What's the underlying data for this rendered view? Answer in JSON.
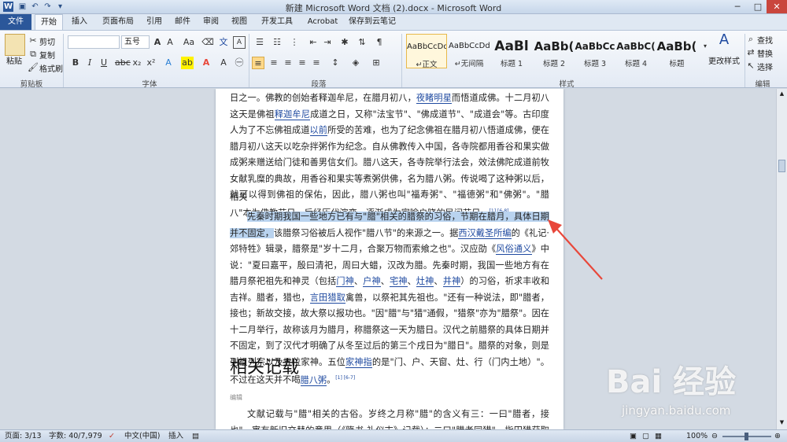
{
  "title": "新建 Microsoft Word 文档 (2).docx - Microsoft Word",
  "tabs": [
    "文件",
    "开始",
    "插入",
    "页面布局",
    "引用",
    "邮件",
    "审阅",
    "视图",
    "开发工具",
    "Acrobat",
    "保存到云笔记"
  ],
  "clipboard": {
    "paste": "粘贴",
    "cut": "剪切",
    "copy": "复制",
    "format_painter": "格式刷",
    "group": "剪贴板"
  },
  "font": {
    "name": "",
    "size": "五号",
    "group": "字体"
  },
  "paragraph_group": "段落",
  "styles": {
    "items": [
      {
        "preview": "AaBbCcDd",
        "name": "↵正文"
      },
      {
        "preview": "AaBbCcDd",
        "name": "↵无间隔"
      },
      {
        "preview": "AaBl",
        "name": "标题 1"
      },
      {
        "preview": "AaBb(",
        "name": "标题 2"
      },
      {
        "preview": "AaBbCc",
        "name": "标题 3"
      },
      {
        "preview": "AaBbC(",
        "name": "标题 4"
      },
      {
        "preview": "AaBb(",
        "name": "标题"
      }
    ],
    "change": "更改样式",
    "group": "样式"
  },
  "editing": {
    "find": "查找",
    "replace": "替换",
    "select": "选择",
    "group": "编辑"
  },
  "document": {
    "p1": "日之一。佛教的创始者释迦牟尼，在腊月初八，",
    "p1_link1": "夜睹明星",
    "p1_b": "而悟道成佛。十二月初八这天是佛祖",
    "p1_link2": "释迦牟尼",
    "p1_c": "成道之日，又称\"法宝节\"、\"佛成道节\"、\"成道会\"等。古印度人为了不忘佛祖成道",
    "p1_link3": "以前",
    "p1_d": "所受的苦难，也为了纪念佛祖在腊月初八悟道成佛，便在腊月初八这天以吃杂拌粥作为纪念。自从佛教传入中国，各寺院都用香谷和果实做成粥来赠送给门徒和善男信女们。腊八这天，各寺院举行法会，效法佛陀成道前牧女献乳糜的典故，用香谷和果实等煮粥供佛，名为腊八粥。传说喝了这种粥以后，就可以得到佛祖的保佑，因此，腊八粥也叫\"福寿粥\"、\"福德粥\"和\"佛粥\"。\"腊八\"本为佛教节日，后经历代演变，逐渐成为家喻户晓的民间节日。",
    "p1_ref": "[1]  [6-8]",
    "h_small": "相关",
    "p2_sel": "先秦时期我国一些地方已有与\"腊\"相关的腊祭的习俗，节期在腊月，具体日期并不固定，",
    "p2_a": "该腊祭习俗被后人视作\"腊八节\"的来源之一。据",
    "p2_link1": "西汉戴圣所编",
    "p2_b": "的《礼记·郊特牲》辑录，腊祭是\"岁十二月，合聚万物而索飨之也\"。汉应劭《",
    "p2_link2": "风俗通义",
    "p2_c": "》中说：\"夏曰嘉平，殷曰清祀，周曰大蜡，汉改为腊。先秦时期，我国一些地方有在腊月祭祀祖先和神灵（包括",
    "p2_link3": "门神",
    "p2_d": "、",
    "p2_link4": "户神",
    "p2_e": "、",
    "p2_link5": "宅神",
    "p2_f": "、",
    "p2_link6": "灶神",
    "p2_g": "、",
    "p2_link7": "井神",
    "p2_h": "）的习俗，祈求丰收和吉祥。腊者，猎也，",
    "p2_link8": "言田猎取",
    "p2_i": "禽兽，以祭祀其先祖也。\"还有一种说法，即\"腊者，接也；新故交接，故大祭以报功也。\"因\"腊\"与\"猎\"通假，\"猎祭\"亦为\"腊祭\"。因在十二月举行，故称该月为腊月，称腊祭这一天为腊日。汉代之前腊祭的具体日期并不固定，到了汉代才明确了从冬至过后的第三个戌日为\"腊日\"。腊祭的对象，则是列祖列宗以及五位家神。五位",
    "p2_link9": "家神指",
    "p2_j": "的是\"门、户、天窗、灶、行（门内土地）\"。不过在这天并不喝",
    "p2_link10": "腊八粥",
    "p2_k": "。",
    "p2_ref": "[1]  [6-7]",
    "heading": "相关记载",
    "edit": "编辑",
    "p3": "文献记载与\"腊\"相关的古俗。岁终之月称\"腊\"的含义有三：一曰\"腊者，接也\"，寓有新旧交替的意思（《隋书·礼仪志》记载）；二曰\"腊者同猎\"，指田猎获取禽兽好祭祖祭神，\"腊\""
  },
  "watermark": {
    "brand": "Bai 经验",
    "url": "jingyan.baidu.com"
  },
  "status": {
    "page": "页面: 3/13",
    "words": "字数: 40/7,979",
    "lang": "中文(中国)",
    "insert": "插入",
    "zoom": "100%"
  },
  "colors": {
    "file_tab": "#2b579a",
    "selection": "#b9d3ef",
    "arrow": "#e8473a"
  }
}
